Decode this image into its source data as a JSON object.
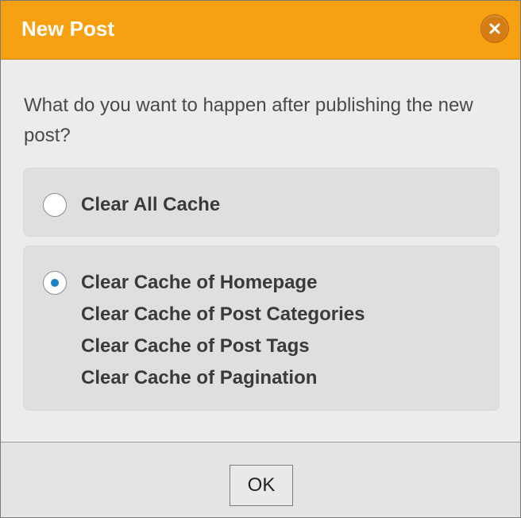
{
  "dialog": {
    "title": "New Post",
    "close_icon": "close-icon",
    "question": "What do you want to happen after publishing the new post?",
    "options": [
      {
        "label": "Clear All Cache",
        "selected": false
      },
      {
        "selected": true,
        "lines": [
          "Clear Cache of Homepage",
          "Clear Cache of Post Categories",
          "Clear Cache of Post Tags",
          "Clear Cache of Pagination"
        ]
      }
    ],
    "ok_label": "OK"
  },
  "colors": {
    "titlebar": "#f7a011",
    "close_button": "#d57d14",
    "radio_dot": "#1a84c7",
    "body_bg": "#ececec",
    "option_bg": "#dfdfdf"
  }
}
